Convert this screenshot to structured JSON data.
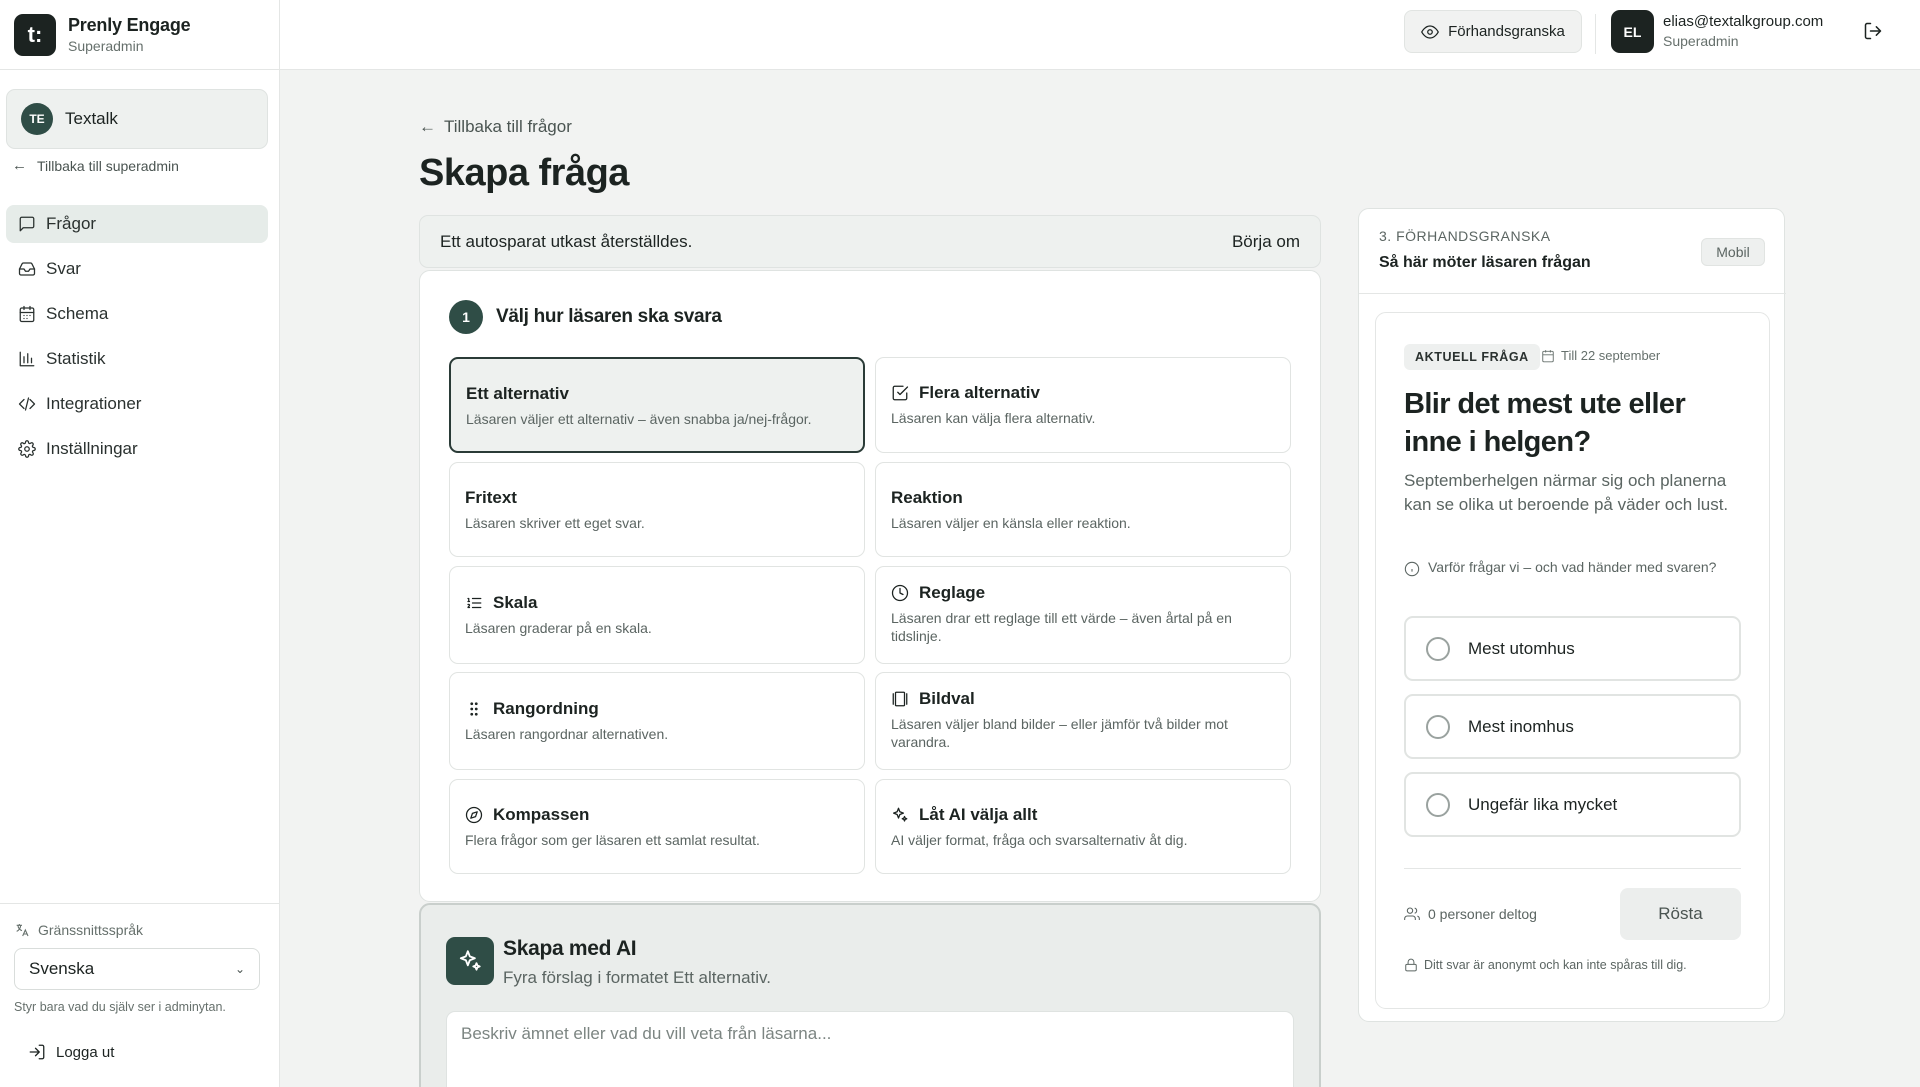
{
  "app": {
    "name": "Prenly Engage",
    "role": "Superadmin",
    "logo": "t:"
  },
  "org": {
    "initials": "TE",
    "name": "Textalk"
  },
  "sidebar": {
    "back_label": "Tillbaka till superadmin",
    "items": [
      {
        "label": "Frågor",
        "icon": "message-square-icon",
        "active": true
      },
      {
        "label": "Svar",
        "icon": "inbox-icon"
      },
      {
        "label": "Schema",
        "icon": "calendar-icon"
      },
      {
        "label": "Statistik",
        "icon": "bar-chart-icon"
      },
      {
        "label": "Integrationer",
        "icon": "code-icon"
      },
      {
        "label": "Inställningar",
        "icon": "gear-icon"
      }
    ],
    "language_label": "Gränssnittsspråk",
    "language_value": "Svenska",
    "language_hint": "Styr bara vad du själv ser i adminytan.",
    "logout_label": "Logga ut"
  },
  "topbar": {
    "preview_label": "Förhandsgranska",
    "user_initials": "EL",
    "user_email": "elias@textalkgroup.com",
    "user_role": "Superadmin"
  },
  "main": {
    "back_label": "Tillbaka till frågor",
    "title": "Skapa fråga",
    "draft_notice": "Ett autosparat utkast återställdes.",
    "draft_action": "Börja om",
    "step": {
      "number": "1",
      "title": "Välj hur läsaren ska svara",
      "options": [
        {
          "title": "Ett alternativ",
          "desc": "Läsaren väljer ett alternativ – även snabba ja/nej-frågor.",
          "selected": true
        },
        {
          "title": "Flera alternativ",
          "desc": "Läsaren kan välja flera alternativ.",
          "icon": "checkbox-icon"
        },
        {
          "title": "Fritext",
          "desc": "Läsaren skriver ett eget svar."
        },
        {
          "title": "Reaktion",
          "desc": "Läsaren väljer en känsla eller reaktion."
        },
        {
          "title": "Skala",
          "desc": "Läsaren graderar på en skala.",
          "icon": "list-ordered-icon"
        },
        {
          "title": "Reglage",
          "desc": "Läsaren drar ett reglage till ett värde – även årtal på en tidslinje.",
          "icon": "clock-icon"
        },
        {
          "title": "Rangordning",
          "desc": "Läsaren rangordnar alternativen.",
          "icon": "drag-handle-icon"
        },
        {
          "title": "Bildval",
          "desc": "Läsaren väljer bland bilder – eller jämför två bilder mot varandra.",
          "icon": "gallery-icon"
        },
        {
          "title": "Kompassen",
          "desc": "Flera frågor som ger läsaren ett samlat resultat.",
          "icon": "compass-icon"
        },
        {
          "title": "Låt AI välja allt",
          "desc": "AI väljer format, fråga och svarsalternativ åt dig.",
          "icon": "sparkles-icon"
        }
      ]
    },
    "ai": {
      "title": "Skapa med AI",
      "subtitle": "Fyra förslag i formatet Ett alternativ.",
      "placeholder": "Beskriv ämnet eller vad du vill veta från läsarna..."
    }
  },
  "preview": {
    "step_label": "3. FÖRHANDSGRANSKA",
    "title": "Så här möter läsaren frågan",
    "device_badge": "Mobil",
    "current_badge": "AKTUELL FRÅGA",
    "deadline": "Till 22 september",
    "question": "Blir det mest ute eller inne i helgen?",
    "description": "Septemberhelgen närmar sig och planerna kan se olika ut beroende på väder och lust.",
    "why_label": "Varför frågar vi – och vad händer med svaren?",
    "answers": [
      "Mest utomhus",
      "Mest inomhus",
      "Ungefär lika mycket"
    ],
    "participants": "0 personer deltog",
    "vote_label": "Rösta",
    "anon_note": "Ditt svar är anonymt och kan inte spåras till dig."
  },
  "colors": {
    "accent": "#2f4d46",
    "text": "#1c2321",
    "muted": "#5b6562",
    "background": "#f2f3f2"
  }
}
